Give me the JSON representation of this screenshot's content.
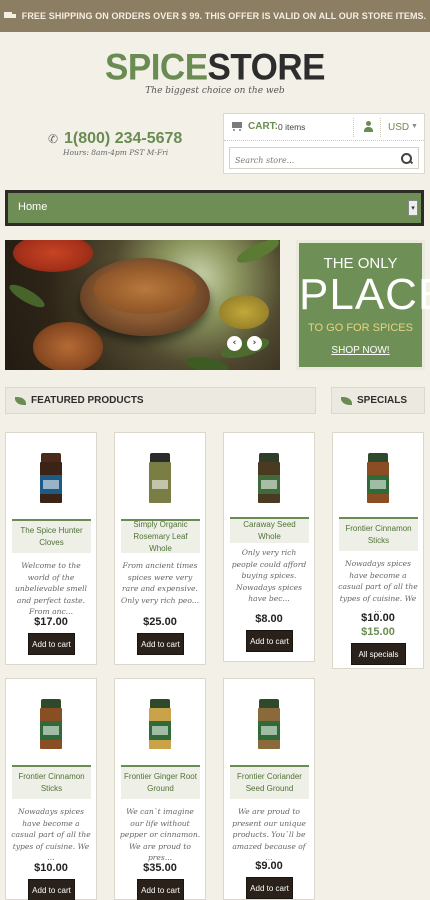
{
  "topbar": {
    "text": "FREE SHIPPING ON ORDERS OVER $ 99. THIS OFFER IS VALID ON ALL OUR STORE ITEMS.",
    "icon": "truck-icon"
  },
  "logo": {
    "part1": "SPICE",
    "part2": "STORE",
    "tagline": "The biggest choice on the web"
  },
  "contact": {
    "phone": "1(800) 234-5678",
    "hours": "Hours: 8am-4pm PST M-Fri",
    "icon": "phone-icon"
  },
  "cart": {
    "label": "CART:",
    "count": "0 items",
    "currency": "USD",
    "search_placeholder": "Search store..."
  },
  "nav": {
    "selected": "Home"
  },
  "slider": {
    "prev": "‹",
    "next": "›"
  },
  "promo": {
    "line1": "THE ONLY",
    "line2": "PLACE",
    "line3": "TO GO FOR SPICES",
    "cta": "SHOP NOW!"
  },
  "sections": {
    "featured": "FEATURED PRODUCTS",
    "specials": "SPECIALS"
  },
  "products": [
    {
      "title": "The Spice Hunter Cloves",
      "desc": "Welcome to the world of the unbelievable smell and perfect taste. From anc...",
      "price": "$17.00",
      "button": "Add to cart",
      "cap": "#4a2a1a",
      "glass": "#3b2416",
      "label": "#1d5a86"
    },
    {
      "title": "Simply Organic Rosemary Leaf Whole",
      "desc": "From ancient times spices were very rare and expensive. Only very rich peo...",
      "price": "$25.00",
      "button": "Add to cart",
      "cap": "#2b2b2b",
      "glass": "#7a7e44",
      "label": "#7a7e44"
    },
    {
      "title": "Caraway Seed Whole",
      "desc": "Only very rich people could afford buying spices. Nowadays spices have bec...",
      "price": "$8.00",
      "button": "Add to cart",
      "cap": "#2f3d2a",
      "glass": "#4b3a22",
      "label": "#3f6a3a"
    },
    {
      "title": "Frontier Cinnamon Sticks",
      "desc": "Nowadays spices have become a casual part of all the types of cuisine. We ...",
      "price": "$10.00",
      "button": "Add to cart",
      "cap": "#2f4a2a",
      "glass": "#8a4e24",
      "label": "#2f6a38"
    },
    {
      "title": "Frontier Ginger Root Ground",
      "desc": "We can`t imagine our life without pepper or cinnamon. We are proud to pres...",
      "price": "$35.00",
      "button": "Add to cart",
      "cap": "#2f4a2a",
      "glass": "#c9a24a",
      "label": "#2f6a38"
    },
    {
      "title": "Frontier Coriander Seed Ground",
      "desc": "We are proud to present our unique products. You`ll be amazed because of ...",
      "price": "$9.00",
      "button": "Add to cart",
      "cap": "#2f4a2a",
      "glass": "#8a6a3a",
      "label": "#2f6a38"
    }
  ],
  "special": {
    "title": "Frontier Cinnamon Sticks",
    "desc": "Nowadays spices have become a casual part of all the types of cuisine. We ...",
    "old_price": "$10.00",
    "new_price": "$15.00",
    "button": "All specials",
    "cap": "#2f4a2a",
    "glass": "#8a4e24",
    "label": "#2f6a38"
  },
  "colors": {
    "accent": "#6a8c52",
    "dark": "#2a211a",
    "topbar": "#8c7e62"
  }
}
